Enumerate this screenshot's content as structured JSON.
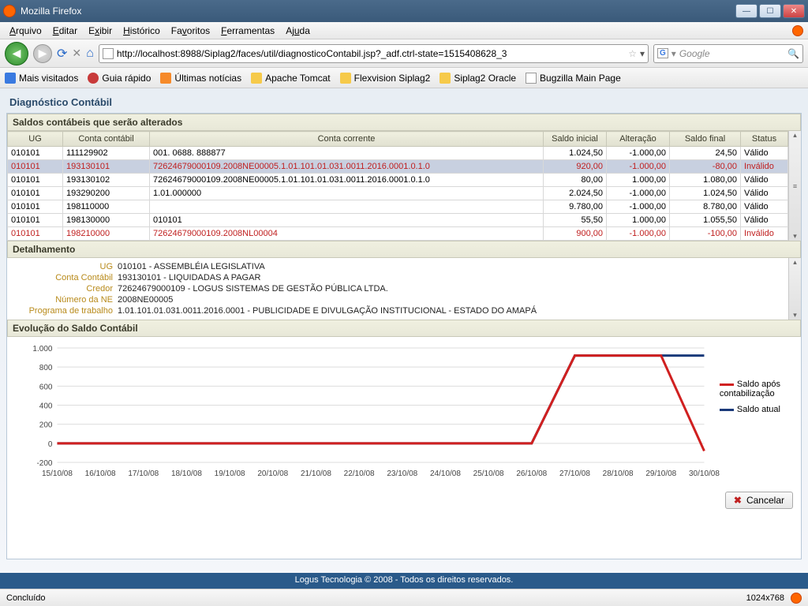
{
  "window": {
    "title": "Mozilla Firefox"
  },
  "menu": [
    "Arquivo",
    "Editar",
    "Exibir",
    "Histórico",
    "Favoritos",
    "Ferramentas",
    "Ajuda"
  ],
  "url": "http://localhost:8988/Siplag2/faces/util/diagnosticoContabil.jsp?_adf.ctrl-state=1515408628_3",
  "search_placeholder": "Google",
  "bookmarks": [
    "Mais visitados",
    "Guia rápido",
    "Últimas notícias",
    "Apache Tomcat",
    "Flexvision Siplag2",
    "Siplag2 Oracle",
    "Bugzilla Main Page"
  ],
  "page_title": "Diagnóstico Contábil",
  "section1_title": "Saldos contábeis que serão alterados",
  "grid_headers": [
    "UG",
    "Conta contábil",
    "Conta corrente",
    "Saldo inicial",
    "Alteração",
    "Saldo final",
    "Status"
  ],
  "grid_rows": [
    {
      "ug": "010101",
      "conta": "111129902",
      "cc": "001. 0688. 888877",
      "si": "1.024,50",
      "alt": "-1.000,00",
      "sf": "24,50",
      "st": "Válido",
      "red": false,
      "sel": false
    },
    {
      "ug": "010101",
      "conta": "193130101",
      "cc": "72624679000109.2008NE00005.1.01.101.01.031.0011.2016.0001.0.1.0",
      "si": "920,00",
      "alt": "-1.000,00",
      "sf": "-80,00",
      "st": "Inválido",
      "red": true,
      "sel": true
    },
    {
      "ug": "010101",
      "conta": "193130102",
      "cc": "72624679000109.2008NE00005.1.01.101.01.031.0011.2016.0001.0.1.0",
      "si": "80,00",
      "alt": "1.000,00",
      "sf": "1.080,00",
      "st": "Válido",
      "red": false,
      "sel": false
    },
    {
      "ug": "010101",
      "conta": "193290200",
      "cc": "1.01.000000",
      "si": "2.024,50",
      "alt": "-1.000,00",
      "sf": "1.024,50",
      "st": "Válido",
      "red": false,
      "sel": false
    },
    {
      "ug": "010101",
      "conta": "198110000",
      "cc": "",
      "si": "9.780,00",
      "alt": "-1.000,00",
      "sf": "8.780,00",
      "st": "Válido",
      "red": false,
      "sel": false
    },
    {
      "ug": "010101",
      "conta": "198130000",
      "cc": "010101",
      "si": "55,50",
      "alt": "1.000,00",
      "sf": "1.055,50",
      "st": "Válido",
      "red": false,
      "sel": false
    },
    {
      "ug": "010101",
      "conta": "198210000",
      "cc": "72624679000109.2008NL00004",
      "si": "900,00",
      "alt": "-1.000,00",
      "sf": "-100,00",
      "st": "Inválido",
      "red": true,
      "sel": false
    }
  ],
  "section2_title": "Detalhamento",
  "details": [
    {
      "label": "UG",
      "value": "010101 - ASSEMBLÉIA LEGISLATIVA"
    },
    {
      "label": "Conta Contábil",
      "value": "193130101 - LIQUIDADAS A PAGAR"
    },
    {
      "label": "Credor",
      "value": "72624679000109 - LOGUS SISTEMAS DE GESTÃO PÚBLICA LTDA."
    },
    {
      "label": "Número da NE",
      "value": "2008NE00005"
    },
    {
      "label": "Programa de trabalho",
      "value": "1.01.101.01.031.0011.2016.0001 - PUBLICIDADE E DIVULGAÇÃO INSTITUCIONAL - ESTADO DO AMAPÁ"
    }
  ],
  "section3_title": "Evolução do Saldo Contábil",
  "chart_data": {
    "type": "line",
    "categories": [
      "15/10/08",
      "16/10/08",
      "17/10/08",
      "18/10/08",
      "19/10/08",
      "20/10/08",
      "21/10/08",
      "22/10/08",
      "23/10/08",
      "24/10/08",
      "25/10/08",
      "26/10/08",
      "27/10/08",
      "28/10/08",
      "29/10/08",
      "30/10/08"
    ],
    "series": [
      {
        "name": "Saldo atual",
        "color": "#1a3a7a",
        "values": [
          0,
          0,
          0,
          0,
          0,
          0,
          0,
          0,
          0,
          0,
          0,
          0,
          920,
          920,
          920,
          920
        ]
      },
      {
        "name": "Saldo após contabilização",
        "color": "#d02020",
        "values": [
          0,
          0,
          0,
          0,
          0,
          0,
          0,
          0,
          0,
          0,
          0,
          0,
          920,
          920,
          920,
          -80
        ]
      }
    ],
    "ylabel": "",
    "xlabel": "",
    "ylim": [
      -200,
      1000
    ],
    "yticks": [
      -200,
      0,
      200,
      400,
      600,
      800,
      1000
    ]
  },
  "legend": [
    {
      "label": "Saldo após contabilização",
      "color": "#d02020"
    },
    {
      "label": "Saldo atual",
      "color": "#1a3a7a"
    }
  ],
  "cancel_label": "Cancelar",
  "footer": "Logus Tecnologia © 2008 - Todos os direitos reservados.",
  "status": "Concluído",
  "dimensions": "1024x768"
}
